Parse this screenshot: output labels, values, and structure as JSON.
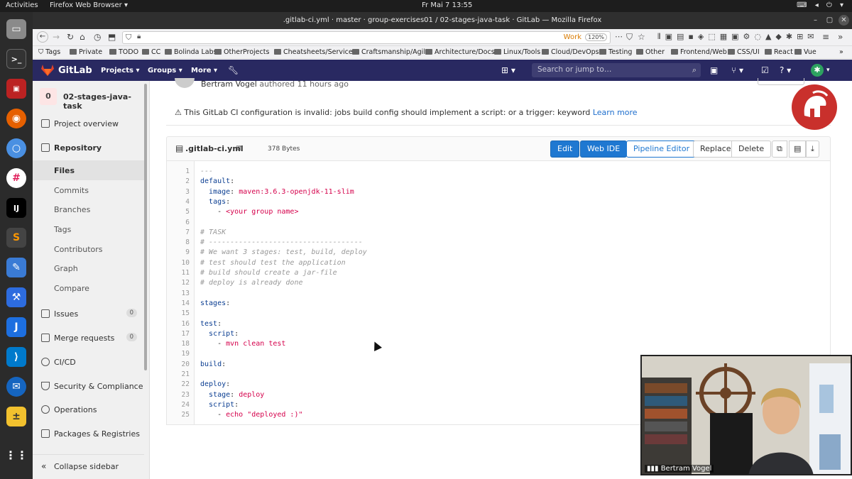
{
  "os": {
    "activities": "Activities",
    "app_menu": "Firefox Web Browser ▾",
    "clock": "Fr Mai 7  13:55"
  },
  "window": {
    "title": ".gitlab-ci.yml · master · group-exercises01 / 02-stages-java-task · GitLab — Mozilla Firefox"
  },
  "browser": {
    "work_label": "Work",
    "zoom": "120%"
  },
  "bookmarks": [
    "Tags",
    "Private",
    "TODO",
    "CC",
    "Bolinda Labs",
    "OtherProjects",
    "Cheatsheets/Services",
    "Craftsmanship/Agile",
    "Architecture/Docs",
    "Linux/Tools",
    "Cloud/DevOps",
    "Testing",
    "Other",
    "Frontend/Web",
    "CSS/UI",
    "React",
    "Vue"
  ],
  "gitlab": {
    "brand": "GitLab",
    "nav": [
      "Projects",
      "Groups",
      "More"
    ],
    "search_placeholder": "Search or jump to…"
  },
  "sidebar": {
    "project_initial": "0",
    "project_name": "02-stages-java-task",
    "items": [
      {
        "label": "Project overview"
      },
      {
        "label": "Repository"
      },
      {
        "label": "Issues",
        "count": "0"
      },
      {
        "label": "Merge requests",
        "count": "0"
      },
      {
        "label": "CI/CD"
      },
      {
        "label": "Security & Compliance"
      },
      {
        "label": "Operations"
      },
      {
        "label": "Packages & Registries"
      }
    ],
    "repo_sub": [
      "Files",
      "Commits",
      "Branches",
      "Tags",
      "Contributors",
      "Graph",
      "Compare"
    ],
    "collapse": "Collapse sidebar"
  },
  "commit": {
    "author": "Bertram Vogel",
    "meta": "authored 11 hours ago"
  },
  "alert": {
    "text": "This GitLab CI configuration is invalid: jobs build config should implement a script: or a trigger: keyword",
    "link": "Learn more"
  },
  "file": {
    "name": ".gitlab-ci.yml",
    "size": "378 Bytes",
    "buttons": {
      "edit": "Edit",
      "webide": "Web IDE",
      "pipeline": "Pipeline Editor",
      "replace": "Replace",
      "delete": "Delete"
    }
  },
  "code": [
    "---",
    "default:",
    "  image: maven:3.6.3-openjdk-11-slim",
    "  tags:",
    "    - <your group name>",
    "",
    "# TASK",
    "# ------------------------------------",
    "# We want 3 stages: test, build, deploy",
    "# test should test the application",
    "# build should create a jar-file",
    "# deploy is already done",
    "",
    "stages:",
    "",
    "test:",
    "  script:",
    "    - mvn clean test",
    "",
    "build:",
    "",
    "deploy:",
    "  stage: deploy",
    "  script:",
    "    - echo \"deployed :)\""
  ],
  "webcam": {
    "name": "Bertram Vogel"
  }
}
